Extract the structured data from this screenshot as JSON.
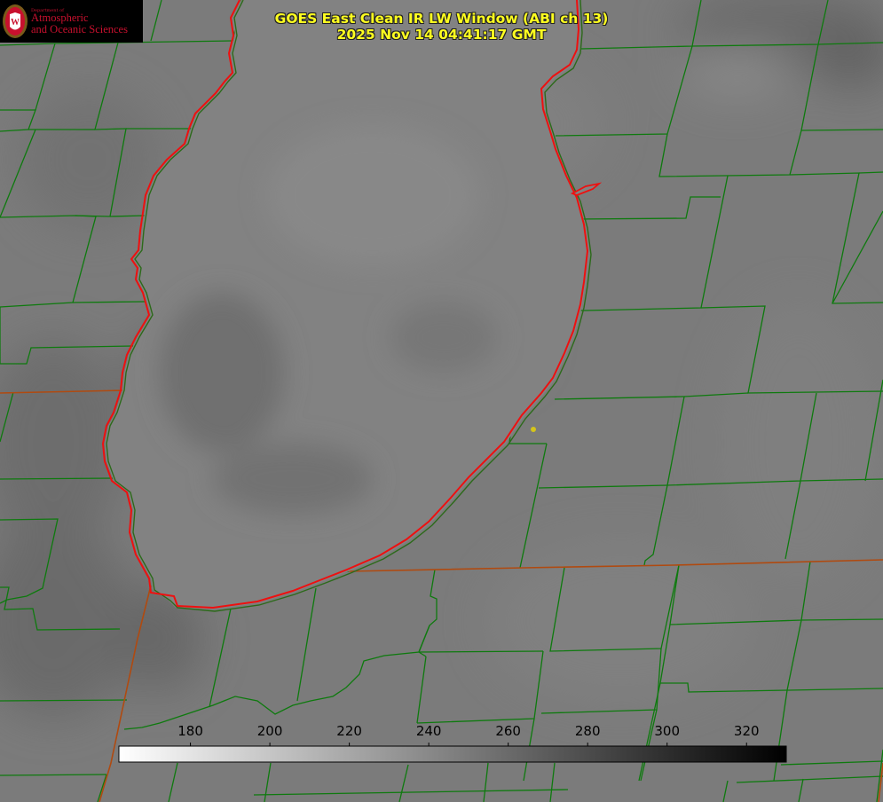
{
  "header": {
    "title_line1": "GOES East Clean IR LW Window (ABI ch 13)",
    "title_line2": "2025 Nov 14 04:41:17 GMT"
  },
  "logo": {
    "dept": "Department of",
    "line1": "Atmospheric",
    "line2": "and Oceanic Sciences",
    "seal_letter": "W"
  },
  "colorbar": {
    "min": 162,
    "max": 330,
    "ticks": [
      180,
      200,
      220,
      240,
      260,
      280,
      300,
      320
    ],
    "tick_labels": [
      "180",
      "200",
      "220",
      "240",
      "260",
      "280",
      "300",
      "320"
    ],
    "start_color": "#ffffff",
    "end_color": "#000000"
  },
  "map_style": {
    "background": "#7a7a7a",
    "boundary_color": "#0e7a0e",
    "coastline_color": "#e00000",
    "marker_color": "#d4c41a"
  }
}
